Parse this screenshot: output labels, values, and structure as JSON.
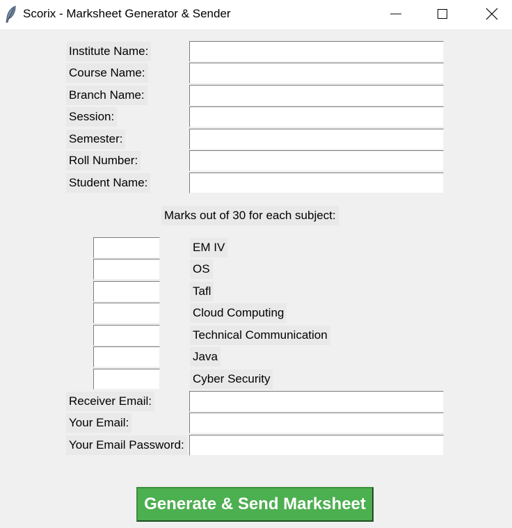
{
  "window": {
    "title": "Scorix - Marksheet Generator & Sender"
  },
  "form": {
    "fields": [
      {
        "label": "Institute Name:",
        "value": ""
      },
      {
        "label": "Course Name:",
        "value": ""
      },
      {
        "label": "Branch Name:",
        "value": ""
      },
      {
        "label": "Session:",
        "value": ""
      },
      {
        "label": "Semester:",
        "value": ""
      },
      {
        "label": "Roll Number:",
        "value": ""
      },
      {
        "label": "Student Name:",
        "value": ""
      }
    ],
    "marks_heading": "Marks out of 30 for each subject:",
    "subjects": [
      {
        "name": "EM IV",
        "mark": ""
      },
      {
        "name": "OS",
        "mark": ""
      },
      {
        "name": "Tafl",
        "mark": ""
      },
      {
        "name": "Cloud Computing",
        "mark": ""
      },
      {
        "name": "Technical Communication",
        "mark": ""
      },
      {
        "name": "Java",
        "mark": ""
      },
      {
        "name": "Cyber Security",
        "mark": ""
      }
    ],
    "email_fields": [
      {
        "label": "Receiver Email:",
        "value": ""
      },
      {
        "label": "Your Email:",
        "value": ""
      },
      {
        "label": "Your Email Password:",
        "value": ""
      }
    ],
    "submit_label": "Generate & Send Marksheet"
  },
  "colors": {
    "button_bg": "#4caf50",
    "button_text": "#ffffff",
    "window_bg": "#f0f0f0"
  },
  "icons": {
    "app": "feather-icon",
    "minimize": "minimize-icon",
    "maximize": "maximize-icon",
    "close": "close-icon"
  }
}
